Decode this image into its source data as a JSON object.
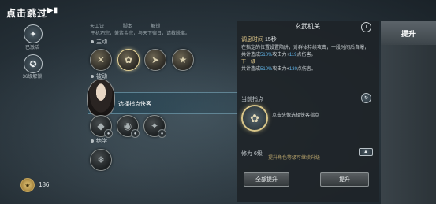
{
  "top": {
    "skip_label": "点击跳过"
  },
  "sidebar": {
    "items": [
      {
        "label": "已激活"
      },
      {
        "label": "36级解锁"
      }
    ]
  },
  "tabs": [
    "天工诀",
    "脚本",
    "解锁"
  ],
  "skills": {
    "intro": "于机巧宗，兼紫金宗，与天下宿日，请教脱离。",
    "active_label": "主动",
    "passive_label": "被动",
    "ultimate_label": "绝学",
    "tooltip": "选择指点侠客"
  },
  "currency": {
    "value": "186"
  },
  "detail": {
    "name": "玄武机关",
    "cooldown_label": "调息时间",
    "cooldown_value": "15秒",
    "desc_line1": "在指定的位置设置陷阱，对群体持续攻击，一段时间后自爆，",
    "desc_prefix": "共计造成",
    "desc_ratio": "510%",
    "desc_mid": "攻击力+",
    "desc_flat": "119",
    "desc_suffix": "点伤害。",
    "next_label": "下一级",
    "next_ratio": "510%",
    "next_flat": "130",
    "current_label": "当前指点",
    "current_hint": "点击头像选择侠客指点",
    "level_label": "修为",
    "level_value": "6级",
    "level_hint": "提升角色等级可继续升级",
    "upgrade_all_label": "全部提升",
    "upgrade_label": "提升"
  },
  "right_tab": {
    "label": "提升"
  }
}
